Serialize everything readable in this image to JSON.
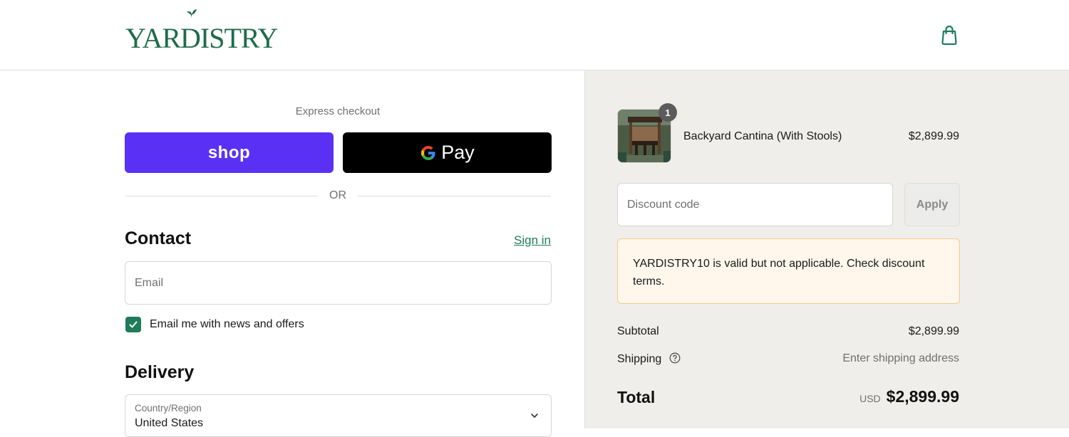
{
  "header": {
    "logo_text": "YARDISTRY",
    "cart_icon": "shopping-bag-icon",
    "brand_color": "#1e6b4c"
  },
  "express": {
    "label": "Express checkout",
    "shop_label": "shop",
    "gpay_label": "Pay",
    "shop_color": "#5a31f4",
    "or_label": "OR"
  },
  "contact": {
    "title": "Contact",
    "signin_label": "Sign in",
    "email_placeholder": "Email",
    "news_label": "Email me with news and offers",
    "news_checked": true
  },
  "delivery": {
    "title": "Delivery",
    "country_label": "Country/Region",
    "country_value": "United States"
  },
  "summary": {
    "product": {
      "name": "Backyard Cantina (With Stools)",
      "price": "$2,899.99",
      "quantity": "1"
    },
    "discount_placeholder": "Discount code",
    "apply_label": "Apply",
    "notice": "YARDISTRY10 is valid but not applicable. Check discount terms.",
    "subtotal_label": "Subtotal",
    "subtotal_value": "$2,899.99",
    "shipping_label": "Shipping",
    "shipping_value": "Enter shipping address",
    "total_label": "Total",
    "currency": "USD",
    "total_value": "$2,899.99"
  }
}
